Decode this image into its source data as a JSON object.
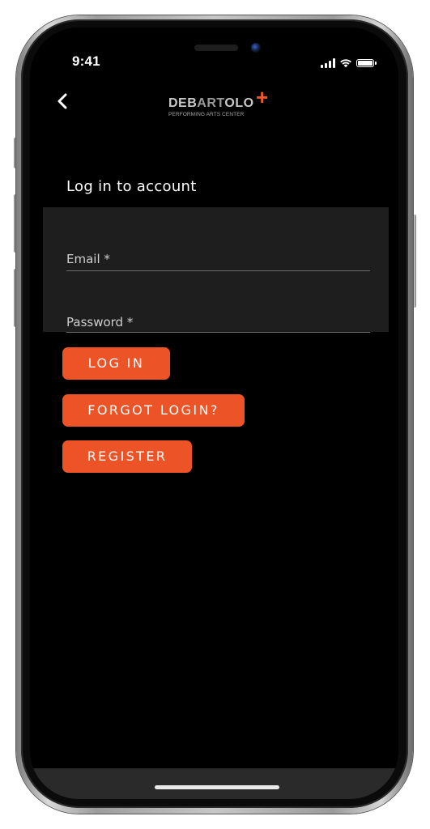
{
  "status_bar": {
    "time": "9:41",
    "icons": [
      "cellular-signal-icon",
      "wifi-icon",
      "battery-icon"
    ]
  },
  "header": {
    "back_icon": "chevron-left-icon",
    "logo": {
      "word_part1": "DEB",
      "word_part2": "ART",
      "word_part3": "OLO",
      "plus": "+",
      "subtitle": "PERFORMING ARTS CENTER"
    }
  },
  "main": {
    "title": "Log in to account",
    "email_placeholder": "Email *",
    "password_placeholder": "Password *",
    "buttons": {
      "login": "LOG IN",
      "forgot": "FORGOT LOGIN?",
      "register": "REGISTER"
    }
  },
  "colors": {
    "accent": "#ec5326",
    "background": "#000000",
    "panel": "#1e1e1e"
  }
}
